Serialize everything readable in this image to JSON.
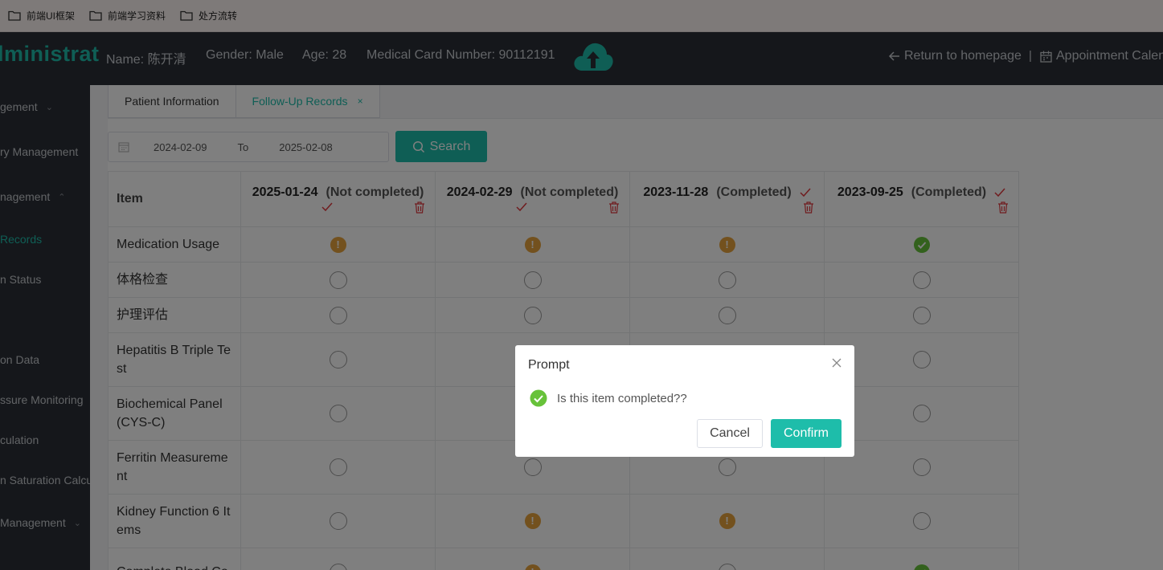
{
  "bookmarks": [
    {
      "label": "前端UI框架",
      "icon": "folder-icon"
    },
    {
      "label": "前端学习资料",
      "icon": "folder-icon"
    },
    {
      "label": "处方流转",
      "icon": "folder-icon"
    }
  ],
  "header": {
    "brand": "dministrat",
    "name": "Name: 陈开清",
    "gender": "Gender: Male",
    "age": "Age: 28",
    "card": "Medical Card Number: 90112191",
    "upload_icon": "cloud-upload-icon",
    "return_home": "Return to homepage",
    "separator": "|",
    "appointment": "Appointment Calen"
  },
  "sidebar": {
    "items": [
      {
        "label": "gement",
        "chevron": "down"
      },
      {
        "label": "ry Management"
      },
      {
        "label": "nagement",
        "chevron": "up"
      },
      {
        "label": " Records",
        "active": true
      },
      {
        "label": "n Status"
      },
      {
        "label": "on Data"
      },
      {
        "label": "ssure Monitoring"
      },
      {
        "label": "culation"
      },
      {
        "label": "n Saturation Calcul"
      },
      {
        "label": "Management",
        "chevron": "down"
      }
    ]
  },
  "tabs": [
    {
      "label": "Patient Information",
      "active": false
    },
    {
      "label": "Follow-Up Records",
      "active": true,
      "close": "×"
    }
  ],
  "filter": {
    "start_date": "2024-02-09",
    "to_label": "To",
    "end_date": "2025-02-08",
    "search_label": "Search"
  },
  "table": {
    "item_header": "Item",
    "columns": [
      {
        "date": "2025-01-24",
        "status": "(Not completed)"
      },
      {
        "date": "2024-02-29",
        "status": "(Not completed)"
      },
      {
        "date": "2023-11-28",
        "status": "(Completed)"
      },
      {
        "date": "2023-09-25",
        "status": "(Completed)"
      }
    ],
    "rows": [
      {
        "name": "Medication Usage",
        "cells": [
          "warn",
          "warn",
          "warn",
          "ok"
        ]
      },
      {
        "name": "体格检查",
        "cells": [
          "empty",
          "empty",
          "empty",
          "empty"
        ]
      },
      {
        "name": "护理评估",
        "cells": [
          "empty",
          "empty",
          "empty",
          "empty"
        ]
      },
      {
        "name": "Hepatitis B Triple Te st",
        "cells": [
          "empty",
          "empty",
          "empty",
          "empty"
        ]
      },
      {
        "name": "Biochemical Panel (CYS-C)",
        "cells": [
          "empty",
          "empty",
          "empty",
          "empty"
        ]
      },
      {
        "name": "Ferritin Measureme nt",
        "cells": [
          "empty",
          "empty",
          "empty",
          "empty"
        ]
      },
      {
        "name": "Kidney Function 6 It ems",
        "cells": [
          "empty",
          "warn",
          "warn",
          "empty"
        ]
      },
      {
        "name": "Complete Blood Co",
        "cells": [
          "empty",
          "warn",
          "empty",
          "ok"
        ]
      }
    ]
  },
  "dialog": {
    "title": "Prompt",
    "message": "Is this item completed??",
    "cancel": "Cancel",
    "confirm": "Confirm"
  },
  "colors": {
    "accent": "#1ebdaa",
    "warning": "#e6a23c",
    "success": "#67c23a",
    "danger": "#e0393e"
  }
}
